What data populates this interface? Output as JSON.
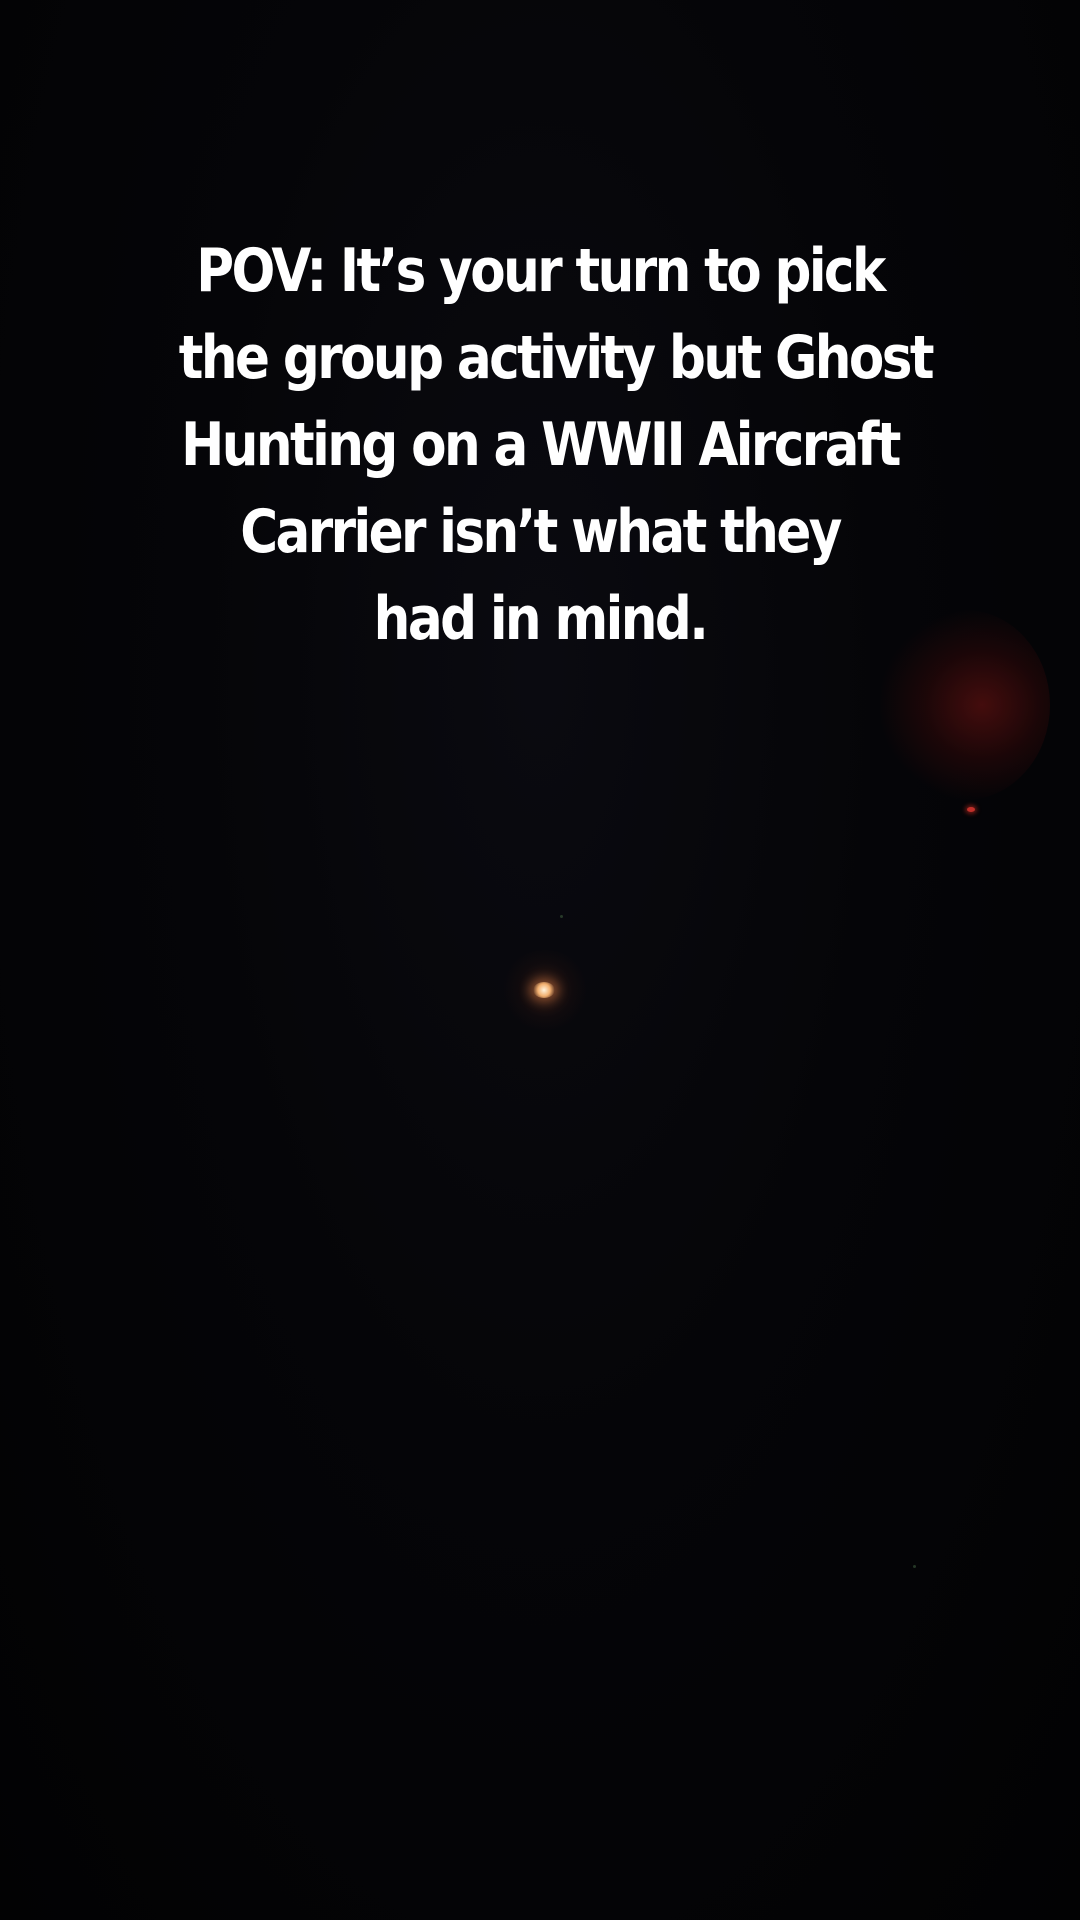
{
  "caption": {
    "lines": [
      "POV: It’s your turn to pick",
      "the group activity but Ghost",
      "Hunting on a WWII Aircraft",
      "Carrier isn’t what they",
      "had in mind."
    ]
  }
}
